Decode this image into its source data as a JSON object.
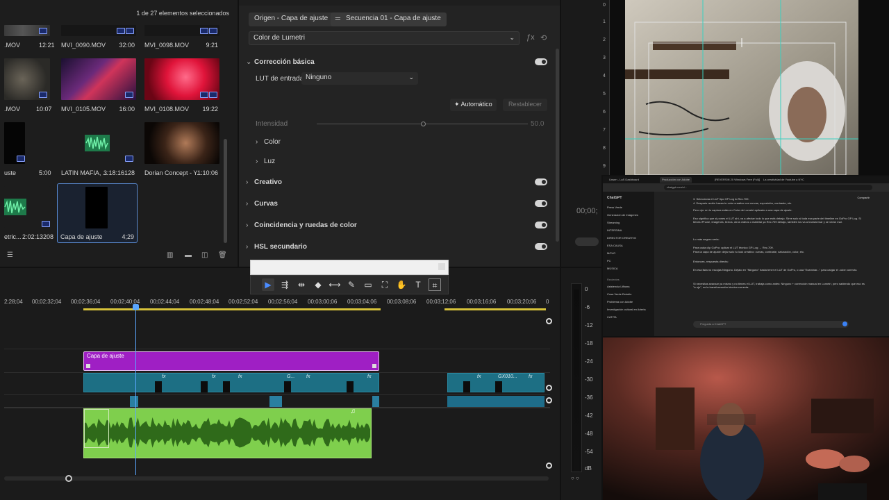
{
  "project": {
    "selection_count": "1 de 27 elementos seleccionados",
    "items": [
      {
        "name": ".MOV",
        "duration": "12:21"
      },
      {
        "name": "MVI_0090.MOV",
        "duration": "32:00"
      },
      {
        "name": "MVI_0098.MOV",
        "duration": "9:21"
      },
      {
        "name": ".MOV",
        "duration": "10:07"
      },
      {
        "name": "MVI_0105.MOV",
        "duration": "16:00"
      },
      {
        "name": "MVI_0108.MOV",
        "duration": "19:22"
      },
      {
        "name": "uste",
        "duration": "5:00"
      },
      {
        "name": "LATIN MAFIA, ...",
        "duration": "3:18:16128"
      },
      {
        "name": "Dorian Concept - Y...",
        "duration": "1:10:06"
      },
      {
        "name": "etric...",
        "duration": "2:02:13208"
      },
      {
        "name": "Capa de ajuste",
        "duration": "4;29"
      }
    ]
  },
  "effects": {
    "source_tab": "Origen - Capa de ajuste",
    "sequence_tab": "Secuencia 01 - Capa de ajuste",
    "effect_select": "Color de Lumetri",
    "sections": {
      "basic": "Corrección básica",
      "lut_label": "LUT de entrada",
      "lut_value": "Ninguno",
      "auto_button": "Automático",
      "reset_button": "Restablecer",
      "intensity_label": "Intensidad",
      "intensity_value": "50.0",
      "color": "Color",
      "light": "Luz",
      "creative": "Creativo",
      "curves": "Curvas",
      "match": "Coincidencia y ruedas de color",
      "hsl": "HSL secundario"
    }
  },
  "program": {
    "timecode": "00;00;"
  },
  "timeline": {
    "ruler": [
      "2;28;04",
      "00;02;32;04",
      "00;02;36;04",
      "00;02;40;04",
      "00;02;44;04",
      "00;02;48;04",
      "00;02;52;04",
      "00;02;56;04",
      "00;03;00;06",
      "00;03;04;06",
      "00;03;08;06",
      "00;03;12;06",
      "00;03;16;06",
      "00;03;20;06",
      "0"
    ],
    "adjustment_clip": "Capa de ajuste",
    "fx_label": "fx",
    "clip_g": "G...",
    "clip_gx": "GX010..."
  },
  "meters": {
    "labels": [
      "0",
      "-6",
      "-12",
      "-18",
      "-24",
      "-30",
      "-36",
      "-42",
      "-48",
      "-54",
      "dB"
    ]
  },
  "browser": {
    "tabs": [
      "Unsen - LaS Dashboard",
      "Producción con Adobe",
      "[REVERSIN 20 Windows Free (Full)]",
      "La creatividad de Youtube a NYC"
    ],
    "url": "chatgpt.com/c/...",
    "app_title": "ChatGPT",
    "share": "Compartir",
    "sidebar": [
      "Press Verde",
      "Generación de Imágenes",
      "Streaming",
      "INTERSINA",
      "DIRECTOR CREATIVO",
      "ESA CAUSA",
      "MOVO",
      "PC",
      "MÚSICA",
      "Recientes",
      "Asistencia Lifbona",
      "Cosa Verde Estudio",
      "Problema con Adobe",
      "Investigación cultural en Arteria",
      "CATITA"
    ],
    "paragraphs": [
      "3. Selecciona el LUT tipo GP Log to Rec.709.",
      "4. Después recién haces tu color creativo con curvas, exposición, contraste, etc.",
      "Pero ojo: en tu captura estás en Color de Lumetri aplicado a una capa de ajuste.",
      "Eso significa que si pones el LUT ahí, va a afectar todo lo que está debajo. Sirve solo si toda esa parte del timeline es GoPro GP Log. Si tienes iPhone, imágenes, textos, otros videos o material ya Rec.709 debajo, también los va a transformar y se verán mal.",
      "Lo más seguro sería:",
      "Para cada clip GoPro: aplicar el LUT técnico GP-Log → Rec.709.",
      "Para la capa de ajuste: dejar solo tu look creativo: curvas, contraste, saturación, color, etc.",
      "Entonces, respuesta directa:",
      "En esa lista no escojas Ninguno. Déjalo en \"Ninguno\" hasta tener el LUT de GoPro, o usa \"Examinar...\" para cargar el .cube correcto.",
      "Si necesitas avanzar ya mismo y no tienes el LUT, trabaja como antes: Ninguno + corrección manual en Lumetri, pero sabiendo que eso es \"a ojo\", no la transformación técnica correcta."
    ],
    "input_placeholder": "Pregunta a ChatGPT"
  }
}
